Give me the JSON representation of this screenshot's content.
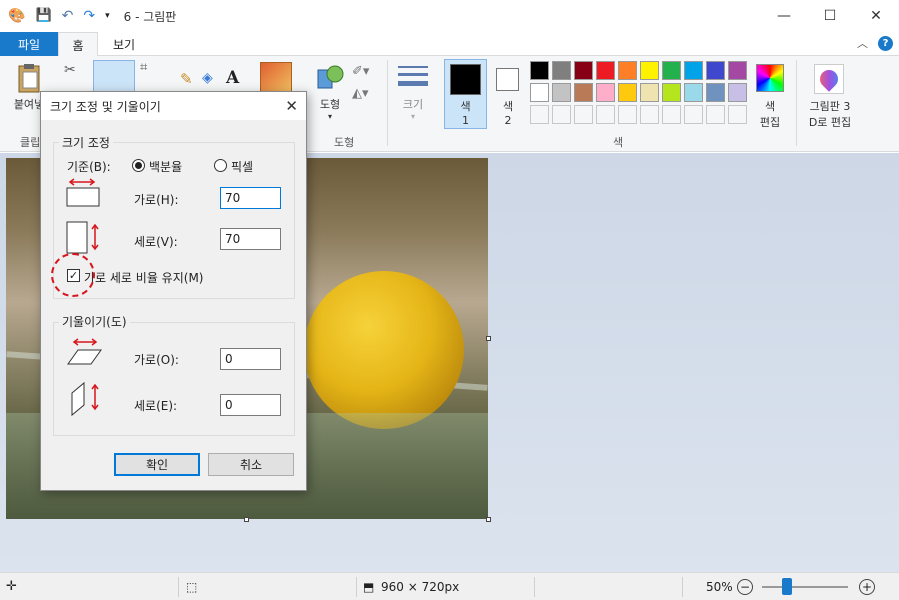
{
  "window": {
    "title": "6 - 그림판",
    "minimize": "—",
    "maximize": "☐",
    "close": "✕"
  },
  "tabs": {
    "file": "파일",
    "home": "홈",
    "view": "보기"
  },
  "ribbon": {
    "paste": "붙여넣",
    "clipboard_group": "클립",
    "shapes": "도형",
    "shapes_group": "도형",
    "size": "크기",
    "color1": "색\n1",
    "color1_a": "색",
    "color1_b": "1",
    "color2_a": "색",
    "color2_b": "2",
    "edit_colors_a": "색",
    "edit_colors_b": "편집",
    "paint3d_a": "그림판 3",
    "paint3d_b": "D로 편집",
    "colors_group": "색",
    "palette_row1": [
      "#000000",
      "#7f7f7f",
      "#880015",
      "#ed1c24",
      "#ff7f27",
      "#fff200",
      "#22b14c",
      "#00a2e8",
      "#3f48cc",
      "#a349a4"
    ],
    "palette_row2": [
      "#ffffff",
      "#c3c3c3",
      "#b97a57",
      "#ffaec9",
      "#ffc90e",
      "#efe4b0",
      "#b5e61d",
      "#99d9ea",
      "#7092be",
      "#c8bfe7"
    ],
    "color1_value": "#000000",
    "color2_value": "#ffffff"
  },
  "dialog": {
    "title": "크기 조정 및 기울이기",
    "resize_group": "크기 조정",
    "basis_label": "기준(B):",
    "percent_label": "백분율",
    "pixel_label": "픽셀",
    "horizontal_label": "가로(H):",
    "horizontal_value": "70",
    "vertical_label": "세로(V):",
    "vertical_value": "70",
    "keep_ratio_label": "가로 세로 비율 유지(M)",
    "skew_group": "기울이기(도)",
    "skew_h_label": "가로(O):",
    "skew_h_value": "0",
    "skew_v_label": "세로(E):",
    "skew_v_value": "0",
    "ok": "확인",
    "cancel": "취소"
  },
  "status": {
    "dimensions": "960 × 720px",
    "zoom": "50%",
    "zoom_level": 0.5
  }
}
